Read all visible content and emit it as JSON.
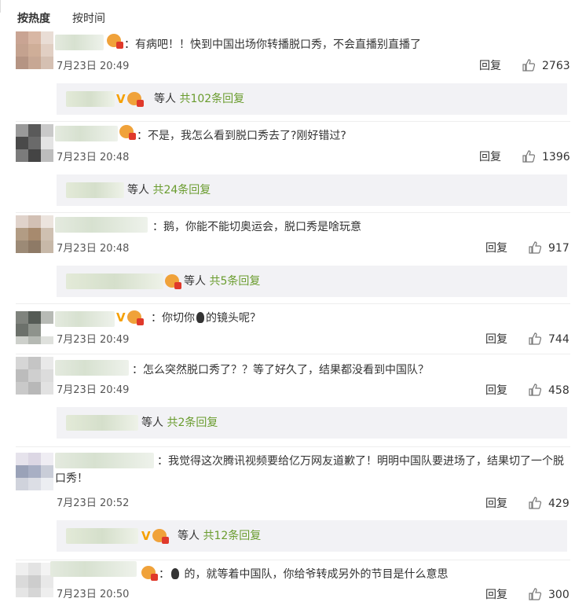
{
  "sort_tabs": {
    "hot": "按热度",
    "time": "按时间"
  },
  "common": {
    "reply_label": "回复",
    "others_label": "等人"
  },
  "comments": [
    {
      "text": "：有病吧！！快到中国出场你转播脱口秀，不会直播别直播了",
      "time": "7月23日 20:49",
      "likes": "2763",
      "replies": {
        "count_text": "共102条回复"
      }
    },
    {
      "text": "：不是，我怎么看到脱口秀去了?刚好错过?",
      "time": "7月23日 20:48",
      "likes": "1396",
      "replies": {
        "count_text": "共24条回复"
      }
    },
    {
      "text": "：鹅，你能不能切奥运会，脱口秀是啥玩意",
      "time": "7月23日 20:48",
      "likes": "917",
      "replies": {
        "count_text": "共5条回复"
      }
    },
    {
      "text_before": "：你切你",
      "text_after": "的镜头呢？",
      "time": "7月23日 20:49",
      "likes": "744"
    },
    {
      "text": "：怎么突然脱口秀了？？等了好久了，结果都没看到中国队？",
      "time": "7月23日 20:49",
      "likes": "458",
      "replies": {
        "count_text": "共2条回复"
      }
    },
    {
      "text": "：我觉得这次腾讯视频要给亿万网友道歉了！明明中国队要进场了，结果切了一个脱口秀！",
      "time": "7月23日 20:52",
      "likes": "429",
      "replies": {
        "count_text": "共12条回复"
      }
    },
    {
      "text_before": "：",
      "text_after": " 的，就等着中国队，你给爷转成另外的节目是什么意思",
      "time": "7月23日 20:50",
      "likes": "300"
    }
  ],
  "colors": {
    "reply_count": "#6a9c2e",
    "v_badge": "#f5a000",
    "sub_bg": "#f2f2f5"
  }
}
